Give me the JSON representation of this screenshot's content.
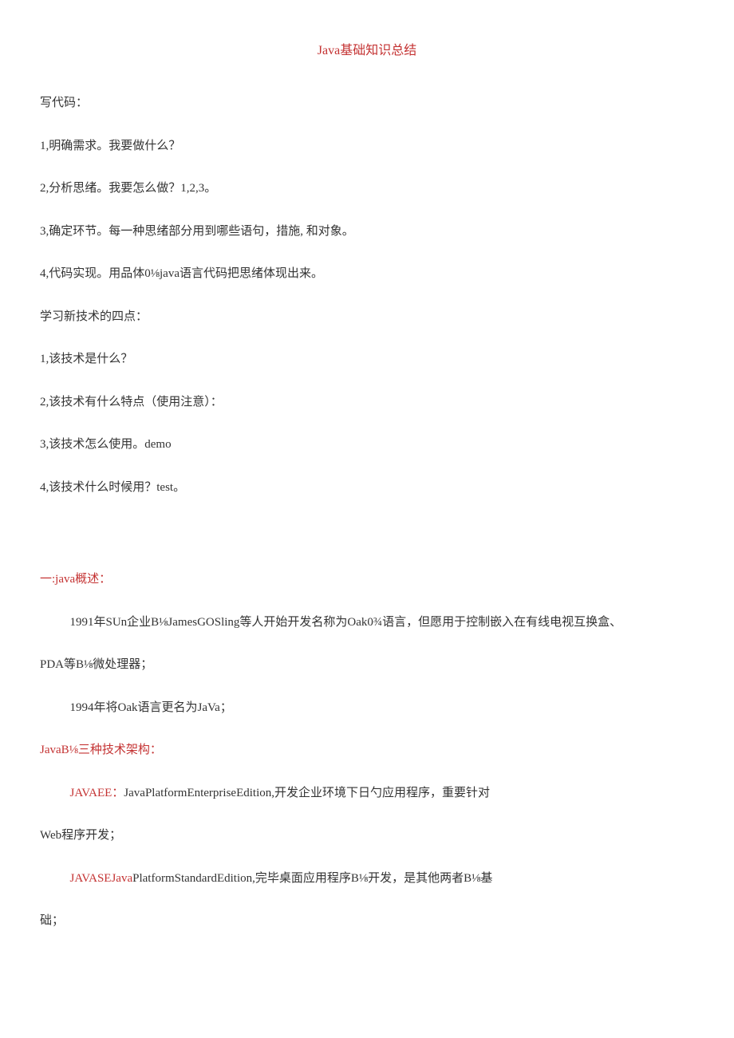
{
  "title": "Java基础知识总结",
  "p1": "写代码：",
  "p2": "1,明确需求。我要做什么？",
  "p3": "2,分析思绪。我要怎么做？1,2,3。",
  "p4": "3,确定环节。每一种思绪部分用到哪些语句，措施, 和对象。",
  "p5": "4,代码实现。用品体0⅛java语言代码把思绪体现出来。",
  "p6": "学习新技术的四点：",
  "p7": "1,该技术是什么？",
  "p8": "2,该技术有什么特点（使用注意）：",
  "p9": "3,该技术怎么使用。demo",
  "p10": "4,该技术什么时候用？test。",
  "p11": "一:java概述：",
  "p12": "1991年SUn企业B⅛JamesGOSling等人开始开发名称为Oak0¾语言，但愿用于控制嵌入在有线电视互换盒、",
  "p13": "PDA等B⅛微处理器；",
  "p14": "1994年将Oak语言更名为JaVa；",
  "p15": "JavaB⅛三种技术架构：",
  "p16a": "JAVAEE：",
  "p16b": "JavaPlatformEnterpriseEdition,开发企业环境下日勺应用程序，重要针对",
  "p17": "Web程序开发；",
  "p18a": "JAVASEJava",
  "p18b": "PlatformStandardEdition,完毕桌面应用程序B⅛开发，是其他两者B⅛基",
  "p19": "础；"
}
